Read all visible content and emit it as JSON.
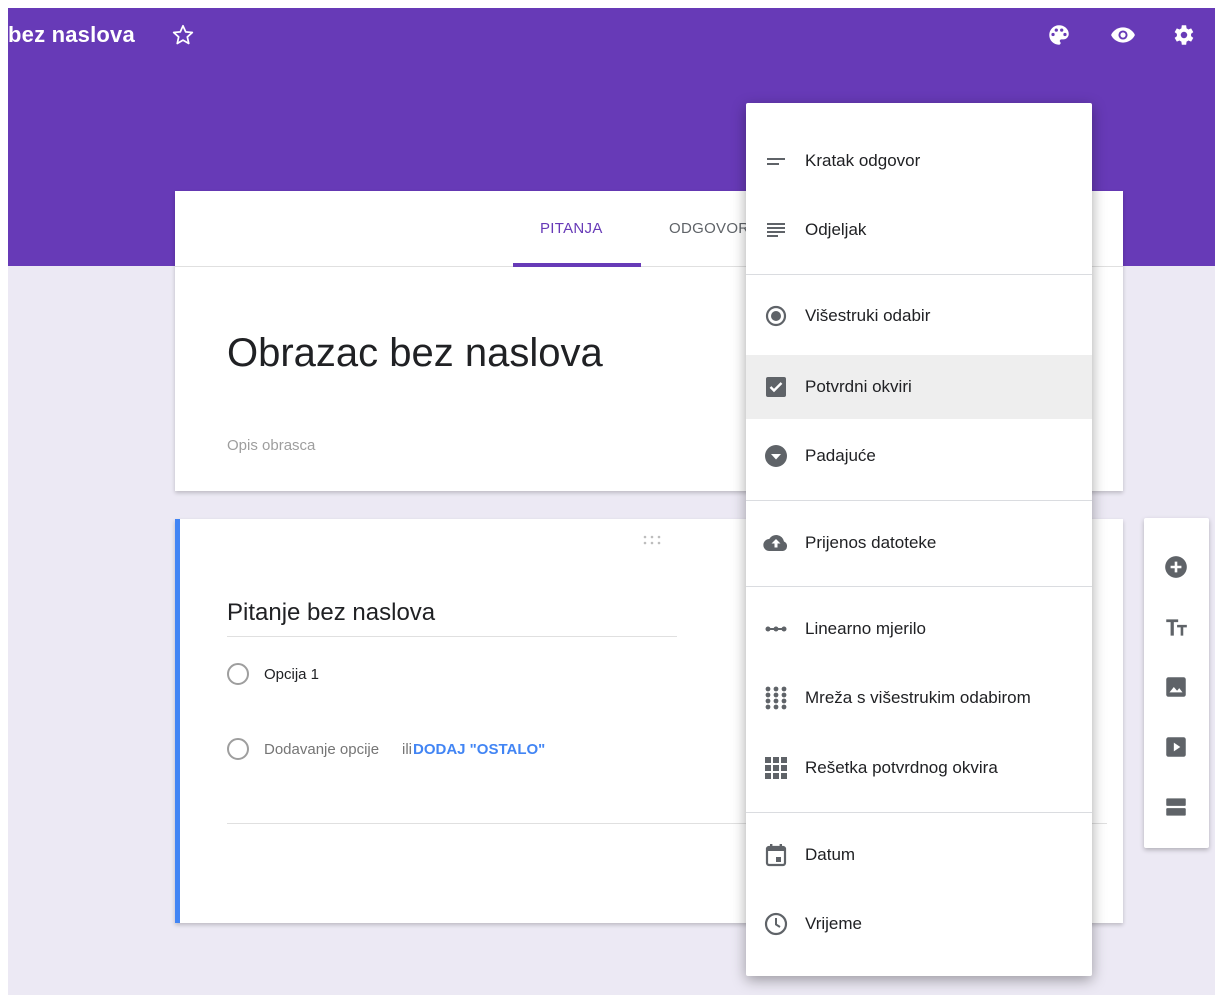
{
  "app": {
    "title": "bez naslova"
  },
  "tabs": [
    {
      "label": "PITANJA"
    },
    {
      "label": "ODGOVORI"
    }
  ],
  "form": {
    "title": "Obrazac bez naslova",
    "description_placeholder": "Opis obrasca"
  },
  "question": {
    "title": "Pitanje bez naslova",
    "option_1": "Opcija 1",
    "add_option": "Dodavanje opcije",
    "or": "ili",
    "add_other": "DODAJ \"OSTALO\""
  },
  "menu": {
    "items": [
      {
        "label": "Kratak odgovor",
        "icon": "short-answer-icon"
      },
      {
        "label": "Odjeljak",
        "icon": "paragraph-icon"
      },
      {
        "label": "Višestruki odabir",
        "icon": "radio-button-icon"
      },
      {
        "label": "Potvrdni okviri",
        "icon": "checkbox-icon"
      },
      {
        "label": "Padajuće",
        "icon": "dropdown-icon"
      },
      {
        "label": "Prijenos datoteke",
        "icon": "cloud-upload-icon"
      },
      {
        "label": "Linearno mjerilo",
        "icon": "linear-scale-icon"
      },
      {
        "label": "Mreža s višestrukim odabirom",
        "icon": "multiple-choice-grid-icon"
      },
      {
        "label": "Rešetka potvrdnog okvira",
        "icon": "checkbox-grid-icon"
      },
      {
        "label": "Datum",
        "icon": "calendar-icon"
      },
      {
        "label": "Vrijeme",
        "icon": "clock-icon"
      }
    ],
    "highlighted": "Potvrdni okviri"
  },
  "colors": {
    "header": "#673ab7",
    "background": "#ece9f4",
    "accent_blue": "#4285f4",
    "icon_gray": "#5f6368"
  }
}
